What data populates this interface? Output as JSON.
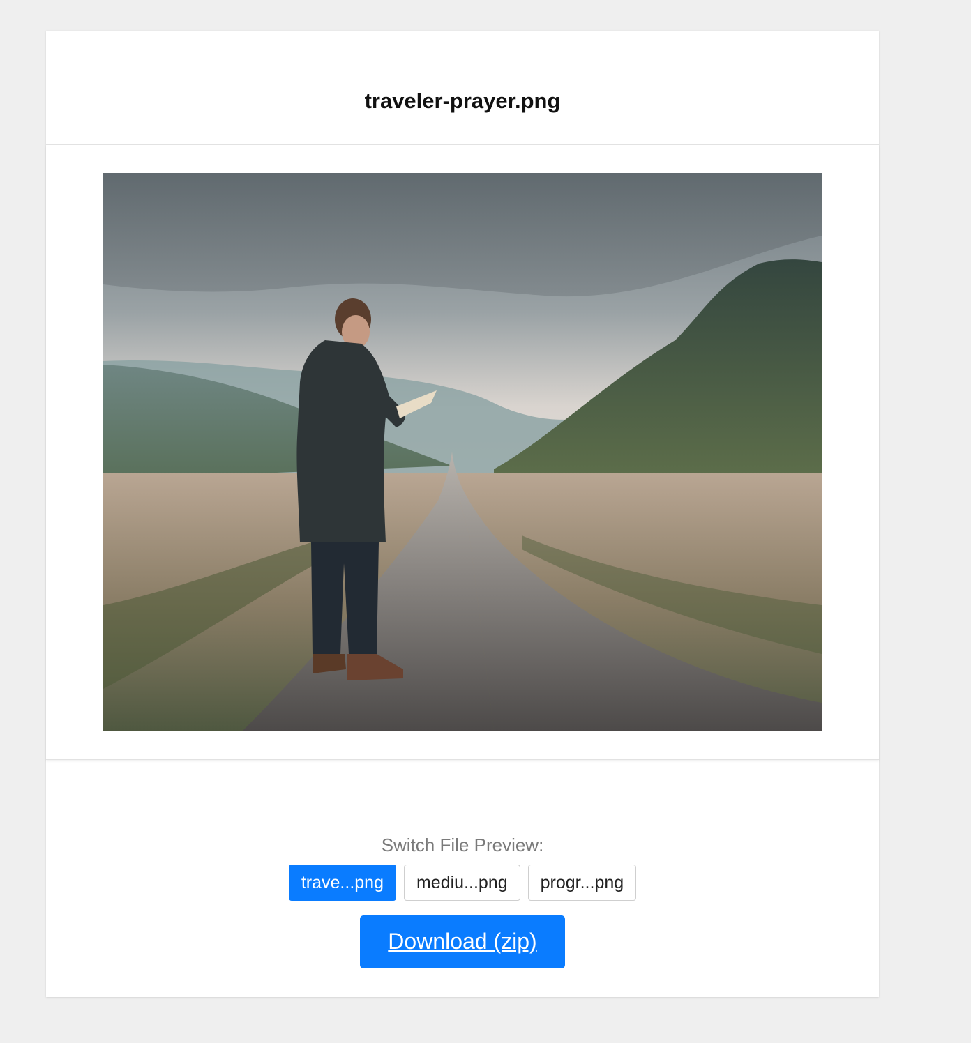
{
  "file_title": "traveler-prayer.png",
  "preview": {
    "image_description_icon": "landscape-photo"
  },
  "switch": {
    "label": "Switch File Preview:",
    "files": [
      {
        "label": "trave...png",
        "active": true
      },
      {
        "label": "mediu...png",
        "active": false
      },
      {
        "label": "progr...png",
        "active": false
      }
    ]
  },
  "download": {
    "label": "Download (zip)"
  },
  "colors": {
    "accent": "#0a7cff",
    "page_background": "#efefef",
    "card_background": "#ffffff"
  }
}
